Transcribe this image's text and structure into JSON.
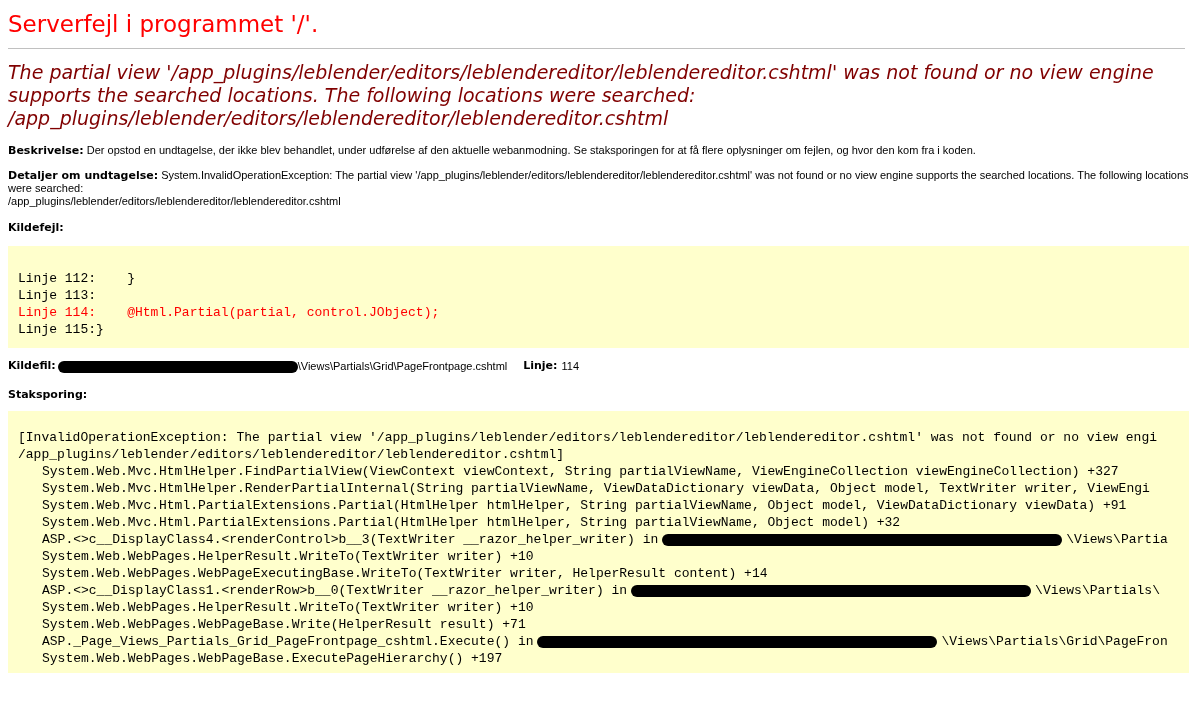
{
  "title": "Serverfejl i programmet '/'.",
  "message": "The partial view '/app_plugins/leblender/editors/leblendereditor/leblendereditor.cshtml' was not found or no view engine supports the searched locations. The following locations were searched:\n/app_plugins/leblender/editors/leblendereditor/leblendereditor.cshtml",
  "description": "**Beskrivelse:** Der opstod en undtagelse, der ikke blev behandlet, under udførelse af den aktuelle webanmodning. Se staksporingen for at få flere oplysninger om fejlen, og hvor den kom fra i koden.",
  "exception_details": "**Detaljer om undtagelse:** System.InvalidOperationException: The partial view '/app_plugins/leblender/editors/leblendereditor/leblendereditor.cshtml' was not found or no view engine supports the searched locations. The following locations were searched:\n/app_plugins/leblender/editors/leblendereditor/leblendereditor.cshtml",
  "source_error_heading": "Kildefejl:",
  "source_lines": [
    {
      "text": "Linje 112:    }",
      "error": false
    },
    {
      "text": "Linje 113:",
      "error": false
    },
    {
      "text": "Linje 114:    @Html.Partial(partial, control.JObject);",
      "error": true
    },
    {
      "text": "Linje 115:}",
      "error": false
    }
  ],
  "source_file": {
    "label": "Kildefil:",
    "redacted": true,
    "path": "\\Views\\Partials\\Grid\\PageFrontpage.cshtml",
    "line_label": "Linje:",
    "line": "114"
  },
  "stack_heading": "Staksporing:",
  "stack_lines": [
    {
      "text": "[InvalidOperationException: The partial view '/app_plugins/leblender/editors/leblendereditor/leblendereditor.cshtml' was not found or no view engi",
      "indent": false,
      "redacted": false
    },
    {
      "text": "/app_plugins/leblender/editors/leblendereditor/leblendereditor.cshtml]",
      "indent": false,
      "redacted": false
    },
    {
      "text": "System.Web.Mvc.HtmlHelper.FindPartialView(ViewContext viewContext, String partialViewName, ViewEngineCollection viewEngineCollection) +327",
      "indent": true,
      "redacted": false
    },
    {
      "text": "System.Web.Mvc.HtmlHelper.RenderPartialInternal(String partialViewName, ViewDataDictionary viewData, Object model, TextWriter writer, ViewEngi",
      "indent": true,
      "redacted": false
    },
    {
      "text": "System.Web.Mvc.Html.PartialExtensions.Partial(HtmlHelper htmlHelper, String partialViewName, Object model, ViewDataDictionary viewData) +91",
      "indent": true,
      "redacted": false
    },
    {
      "text": "System.Web.Mvc.Html.PartialExtensions.Partial(HtmlHelper htmlHelper, String partialViewName, Object model) +32",
      "indent": true,
      "redacted": false
    },
    {
      "text": "ASP.<>c__DisplayClass4.<renderControl>b__3(TextWriter __razor_helper_writer) in",
      "indent": true,
      "redacted": true,
      "after": "\\Views\\Partia"
    },
    {
      "text": "System.Web.WebPages.HelperResult.WriteTo(TextWriter writer) +10",
      "indent": true,
      "redacted": false
    },
    {
      "text": "System.Web.WebPages.WebPageExecutingBase.WriteTo(TextWriter writer, HelperResult content) +14",
      "indent": true,
      "redacted": false
    },
    {
      "text": "ASP.<>c__DisplayClass1.<renderRow>b__0(TextWriter __razor_helper_writer) in",
      "indent": true,
      "redacted": true,
      "after": "\\Views\\Partials\\"
    },
    {
      "text": "System.Web.WebPages.HelperResult.WriteTo(TextWriter writer) +10",
      "indent": true,
      "redacted": false
    },
    {
      "text": "System.Web.WebPages.WebPageBase.Write(HelperResult result) +71",
      "indent": true,
      "redacted": false
    },
    {
      "text": "ASP._Page_Views_Partials_Grid_PageFrontpage_cshtml.Execute() in",
      "indent": true,
      "redacted": true,
      "after": "\\Views\\Partials\\Grid\\PageFron"
    },
    {
      "text": "System.Web.WebPages.WebPageBase.ExecutePageHierarchy() +197",
      "indent": true,
      "redacted": false
    }
  ]
}
